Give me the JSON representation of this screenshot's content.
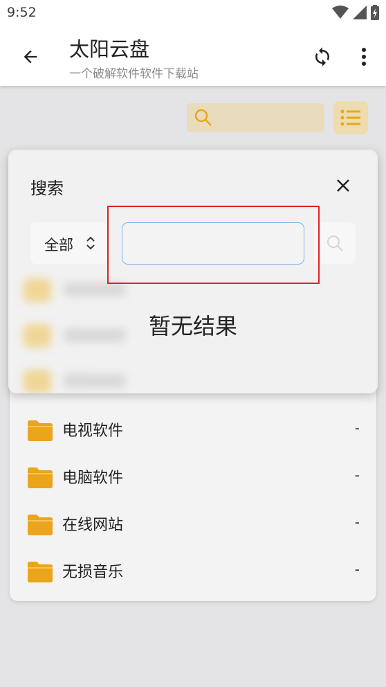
{
  "status_bar": {
    "time": "9:52"
  },
  "app_bar": {
    "title": "太阳云盘",
    "subtitle": "一个破解软件软件下载站"
  },
  "icons": {
    "back": "arrow-back-icon",
    "refresh": "refresh-icon",
    "more": "more-vert-icon",
    "search": "search-icon",
    "list": "list-view-icon",
    "folder": "folder-icon",
    "close": "close-icon",
    "chevron": "unfold-chevron-icon"
  },
  "colors": {
    "accent": "#e6a817",
    "folder": "#eaa51c",
    "highlight": "#e02020",
    "input_border": "#7fb3e6"
  },
  "search_panel": {
    "title": "搜索",
    "filter_selected": "全部",
    "query_value": "",
    "empty_text": "暂无结果"
  },
  "files": [
    {
      "name": "电视软件",
      "size": "-"
    },
    {
      "name": "电脑软件",
      "size": "-"
    },
    {
      "name": "在线网站",
      "size": "-"
    },
    {
      "name": "无损音乐",
      "size": "-"
    }
  ]
}
